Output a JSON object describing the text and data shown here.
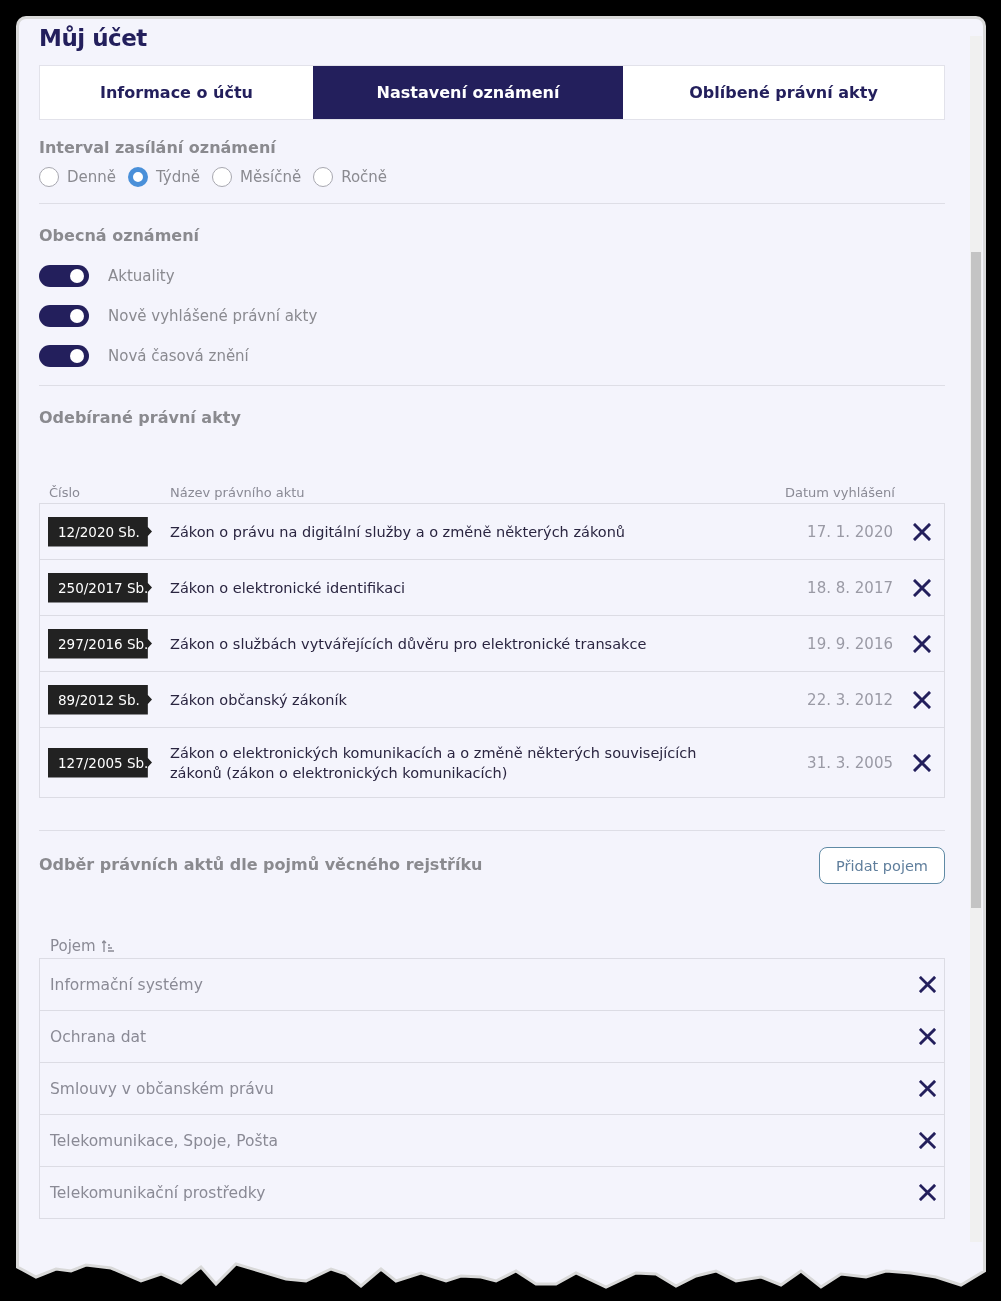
{
  "title": "Můj účet",
  "tabs": [
    {
      "label": "Informace o účtu",
      "selected": false
    },
    {
      "label": "Nastavení oznámení",
      "selected": true
    },
    {
      "label": "Oblíbené právní akty",
      "selected": false
    }
  ],
  "interval": {
    "heading": "Interval zasílání oznámení",
    "options": [
      {
        "label": "Denně",
        "selected": false
      },
      {
        "label": "Týdně",
        "selected": true
      },
      {
        "label": "Měsíčně",
        "selected": false
      },
      {
        "label": "Ročně",
        "selected": false
      }
    ]
  },
  "general": {
    "heading": "Obecná oznámení",
    "toggles": [
      {
        "label": "Aktuality",
        "on": true
      },
      {
        "label": "Nově vyhlášené právní akty",
        "on": true
      },
      {
        "label": "Nová časová znění",
        "on": true
      }
    ]
  },
  "subscribed": {
    "heading": "Odebírané právní akty",
    "columns": [
      "Číslo",
      "Název právního aktu",
      "Datum vyhlášení"
    ],
    "rows": [
      {
        "number": "12/2020 Sb.",
        "name": "Zákon o právu na digitální služby a o změně některých zákonů",
        "date": "17. 1. 2020"
      },
      {
        "number": "250/2017 Sb.",
        "name": "Zákon o elektronické identifikaci",
        "date": "18. 8. 2017"
      },
      {
        "number": "297/2016 Sb.",
        "name": "Zákon o službách vytvářejících důvěru pro elektronické transakce",
        "date": "19. 9. 2016"
      },
      {
        "number": "89/2012 Sb.",
        "name": "Zákon občanský zákoník",
        "date": "22. 3. 2012"
      },
      {
        "number": "127/2005 Sb.",
        "name": "Zákon o elektronických komunikacích a o změně některých souvisejících zákonů (zákon o elektronických komunikacích)",
        "date": "31. 3. 2005"
      }
    ]
  },
  "terms": {
    "heading": "Odběr právních aktů dle pojmů věcného rejstříku",
    "add_button": "Přidat pojem",
    "column": "Pojem",
    "rows": [
      "Informační systémy",
      "Ochrana dat",
      "Smlouvy v občanském právu",
      "Telekomunikace, Spoje, Pošta",
      "Telekomunikační prostředky"
    ]
  }
}
